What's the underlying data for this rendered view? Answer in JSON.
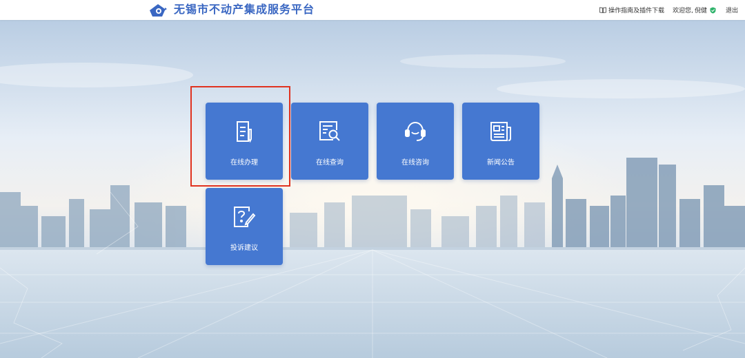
{
  "header": {
    "site_title": "无锡市不动产集成服务平台",
    "guide_link": "操作指南及插件下载",
    "welcome_text": "欢迎您,",
    "username": "倪健",
    "logout": "退出"
  },
  "tiles": [
    {
      "label": "在线办理",
      "icon": "document-pen-icon"
    },
    {
      "label": "在线查询",
      "icon": "document-search-icon"
    },
    {
      "label": "在线咨询",
      "icon": "headset-icon"
    },
    {
      "label": "新闻公告",
      "icon": "newspaper-icon"
    },
    {
      "label": "投诉建议",
      "icon": "question-feedback-icon"
    }
  ],
  "colors": {
    "brand": "#3a67c2",
    "tile": "#4578d1",
    "highlight": "#e0321f"
  }
}
